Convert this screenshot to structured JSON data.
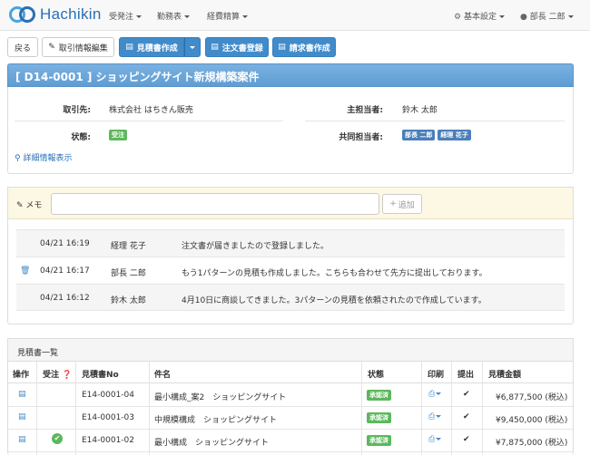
{
  "app": {
    "logo_text": "Hachikin"
  },
  "nav": {
    "left": [
      {
        "label": "受発注"
      },
      {
        "label": "勤務表"
      },
      {
        "label": "経費精算"
      }
    ],
    "settings_label": "基本設定",
    "user_label": "部長 二郎"
  },
  "toolbar": {
    "back": "戻る",
    "edit": "取引情報編集",
    "estimate": "見積書作成",
    "order": "注文書登録",
    "invoice": "請求書作成"
  },
  "deal": {
    "title": "[ D14-0001 ] ショッピングサイト新規構築案件",
    "client_label": "取引先:",
    "client_value": "株式会社 はちきん販売",
    "status_label": "状態:",
    "status_value": "受注",
    "main_owner_label": "主担当者:",
    "main_owner_value": "鈴木 太郎",
    "co_owner_label": "共同担当者:",
    "co_owners": [
      "部長 二郎",
      "経理 花子"
    ],
    "detail_link": "詳細情報表示"
  },
  "memo": {
    "label": "メモ",
    "input_value": "",
    "add_button": "追加",
    "entries": [
      {
        "time": "04/21 16:19",
        "author": "経理 花子",
        "text": "注文書が届きましたので登録しました。",
        "deletable": false
      },
      {
        "time": "04/21 16:17",
        "author": "部長 二郎",
        "text": "もう1パターンの見積も作成しました。こちらも合わせて先方に提出しております。",
        "deletable": true
      },
      {
        "time": "04/21 16:12",
        "author": "鈴木 太郎",
        "text": "4月10日に商談してきました。3パターンの見積を依頼されたので作成しています。",
        "deletable": false
      }
    ]
  },
  "estimates": {
    "title": "見積書一覧",
    "columns": [
      "操作",
      "受注",
      "見積書No",
      "件名",
      "状態",
      "印刷",
      "提出",
      "見積金額"
    ],
    "rows": [
      {
        "no": "E14-0001-04",
        "subject": "最小構成_案2　ショッピングサイト",
        "status": "承認済",
        "submitted": true,
        "ordered": false,
        "amount": "¥6,877,500 (税込)"
      },
      {
        "no": "E14-0001-03",
        "subject": "中規模構成　ショッピングサイト",
        "status": "承認済",
        "submitted": true,
        "ordered": false,
        "amount": "¥9,450,000 (税込)"
      },
      {
        "no": "E14-0001-02",
        "subject": "最小構成　ショッピングサイト",
        "status": "承認済",
        "submitted": true,
        "ordered": true,
        "amount": "¥7,875,000 (税込)"
      }
    ]
  },
  "colors": {
    "primary": "#428bca",
    "title_bar": "#6fa8dc",
    "memo_bg": "#fcf8e3",
    "approved": "#5cb85c",
    "tag_blue": "#4a7fba"
  }
}
